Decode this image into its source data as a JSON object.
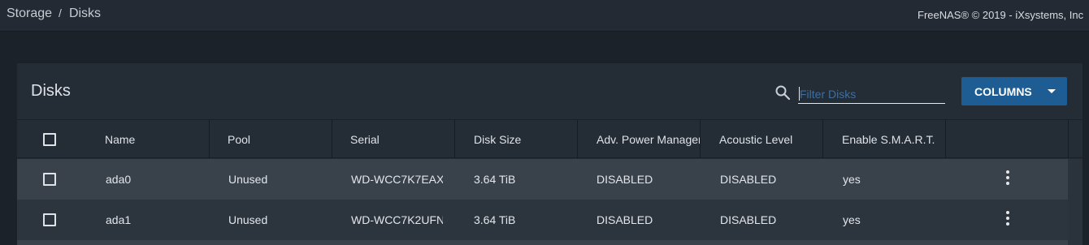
{
  "breadcrumb": {
    "items": [
      "Storage",
      "Disks"
    ],
    "separator": "/"
  },
  "copyright": "FreeNAS® © 2019 - iXsystems, Inc",
  "card": {
    "title": "Disks",
    "filter_placeholder": "Filter Disks",
    "columns_label": "COLUMNS"
  },
  "table": {
    "headers": [
      "Name",
      "Pool",
      "Serial",
      "Disk Size",
      "Adv. Power Management",
      "Acoustic Level",
      "Enable S.M.A.R.T."
    ],
    "rows": [
      [
        "ada0",
        "Unused",
        "WD-WCC7K7EAX",
        "3.64 TiB",
        "DISABLED",
        "DISABLED",
        "yes"
      ],
      [
        "ada1",
        "Unused",
        "WD-WCC7K2UFN",
        "3.64 TiB",
        "DISABLED",
        "DISABLED",
        "yes"
      ]
    ]
  },
  "icons": {
    "search": "search-icon",
    "menu": "more-vert-icon",
    "dropdown": "caret-down-icon"
  },
  "colors": {
    "primary": "#1d5d93",
    "background": "#1b222a",
    "card": "#242c35"
  }
}
